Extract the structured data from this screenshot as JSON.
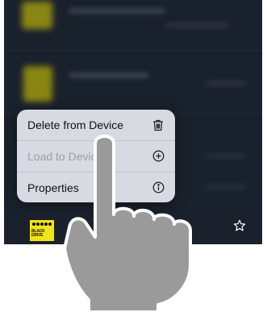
{
  "context_menu": {
    "items": [
      {
        "label": "Delete from Device",
        "icon": "trash-icon",
        "enabled": true
      },
      {
        "label": "Load to Device",
        "icon": "plus-circle-icon",
        "enabled": false
      },
      {
        "label": "Properties",
        "icon": "info-icon",
        "enabled": true
      }
    ]
  },
  "list": {
    "bottom_item": {
      "cover_text": "BLACK DRIVE",
      "favorite_icon": "star-outline-icon"
    }
  },
  "colors": {
    "background": "#1d2531",
    "menu_bg": "#e2e5ea",
    "thumbnail": "#c9c10b",
    "disabled_text": "#9c9fa5"
  }
}
